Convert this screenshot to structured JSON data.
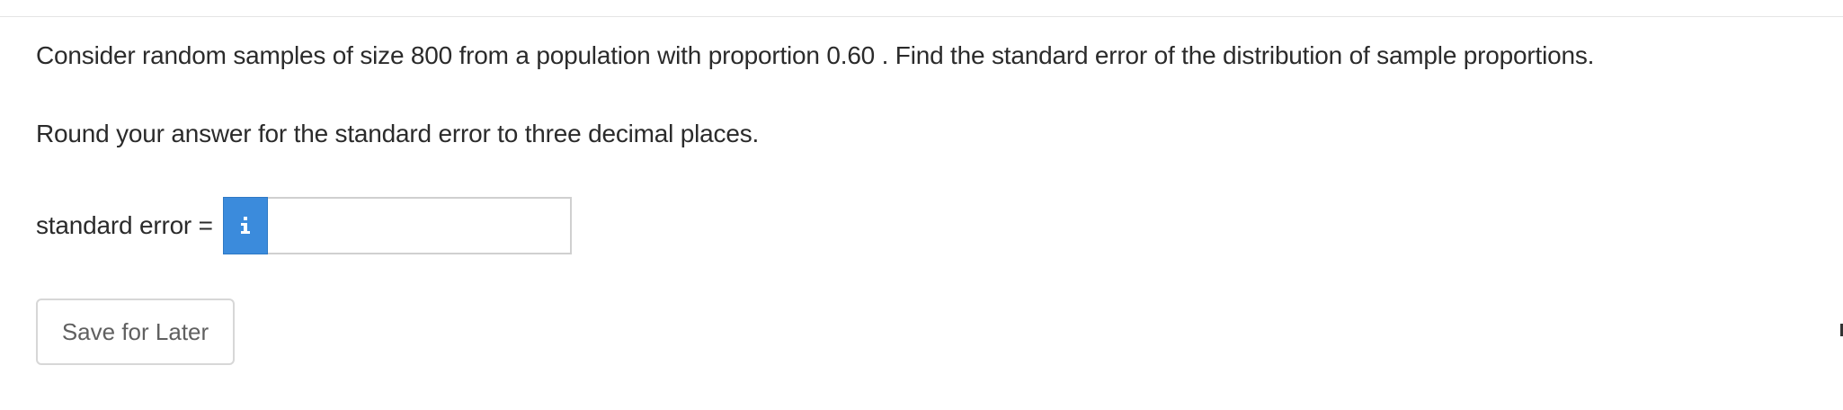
{
  "question": {
    "prompt": "Consider random samples of size 800 from a population with proportion 0.60 . Find the standard error of the distribution of sample proportions.",
    "instruction": "Round your answer for the standard error to three decimal places."
  },
  "answer": {
    "label": "standard error =",
    "value": "",
    "info_icon": "info-icon",
    "info_color": "#3b8bdc"
  },
  "actions": {
    "save_label": "Save for Later"
  }
}
